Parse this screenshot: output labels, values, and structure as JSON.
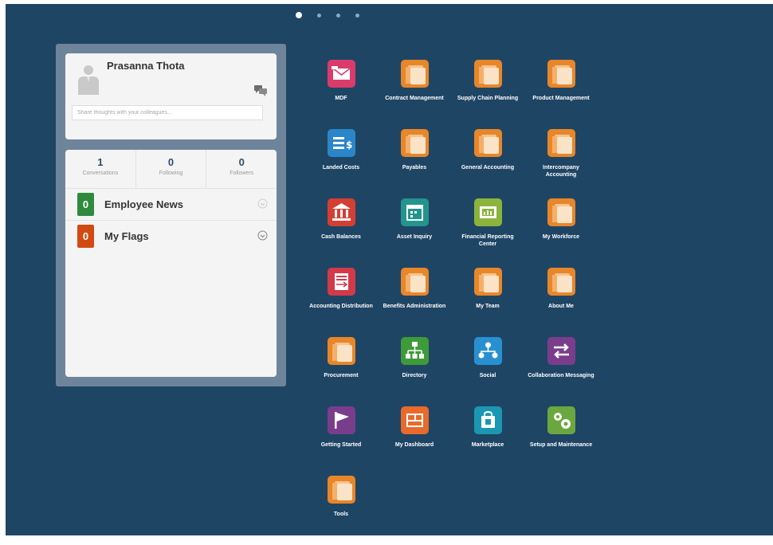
{
  "carousel": {
    "pages": 4,
    "active_page": 1
  },
  "profile": {
    "name": "Prasanna Thota",
    "status_placeholder": "Share thoughts with your colleagues..."
  },
  "stats": [
    {
      "count": "1",
      "label": "Conversations"
    },
    {
      "count": "0",
      "label": "Following"
    },
    {
      "count": "0",
      "label": "Followers"
    }
  ],
  "feeds": [
    {
      "count": "0",
      "label": "Employee News",
      "color": "#2f8a3e"
    },
    {
      "count": "0",
      "label": "My Flags",
      "color": "#d24a12"
    }
  ],
  "tiles": [
    {
      "label": "MDF",
      "icon": "envelope-icon",
      "color": "#d93b6b"
    },
    {
      "label": "Contract Management",
      "icon": "pages-icon",
      "color": "#e8862a"
    },
    {
      "label": "Supply Chain Planning",
      "icon": "pages-icon",
      "color": "#e8862a"
    },
    {
      "label": "Product Management",
      "icon": "pages-icon",
      "color": "#e8862a"
    },
    {
      "label": "Landed Costs",
      "icon": "cost-icon",
      "color": "#2b86c9"
    },
    {
      "label": "Payables",
      "icon": "pages-icon",
      "color": "#e8862a"
    },
    {
      "label": "General Accounting",
      "icon": "pages-icon",
      "color": "#e8862a"
    },
    {
      "label": "Intercompany Accounting",
      "icon": "pages-icon",
      "color": "#e8862a"
    },
    {
      "label": "Cash Balances",
      "icon": "bank-icon",
      "color": "#d33f32"
    },
    {
      "label": "Asset Inquiry",
      "icon": "calendar-icon",
      "color": "#23948e"
    },
    {
      "label": "Financial Reporting Center",
      "icon": "report-icon",
      "color": "#8cb33c"
    },
    {
      "label": "My Workforce",
      "icon": "pages-icon",
      "color": "#e8862a"
    },
    {
      "label": "Accounting Distribution",
      "icon": "ledger-icon",
      "color": "#d33a49"
    },
    {
      "label": "Benefits Administration",
      "icon": "pages-icon",
      "color": "#e8862a"
    },
    {
      "label": "My Team",
      "icon": "pages-icon",
      "color": "#e8862a"
    },
    {
      "label": "About Me",
      "icon": "pages-icon",
      "color": "#e8862a"
    },
    {
      "label": "Procurement",
      "icon": "pages-icon",
      "color": "#e8862a"
    },
    {
      "label": "Directory",
      "icon": "org-chart-icon",
      "color": "#3f9a3a"
    },
    {
      "label": "Social",
      "icon": "network-icon",
      "color": "#2890d1"
    },
    {
      "label": "Collaboration Messaging",
      "icon": "arrows-icon",
      "color": "#7a3d8c"
    },
    {
      "label": "Getting Started",
      "icon": "flag-icon",
      "color": "#7a3d8c"
    },
    {
      "label": "My Dashboard",
      "icon": "dashboard-icon",
      "color": "#e86a2c"
    },
    {
      "label": "Marketplace",
      "icon": "bag-icon",
      "color": "#1c97b3"
    },
    {
      "label": "Setup and Maintenance",
      "icon": "gears-icon",
      "color": "#6aa73e"
    },
    {
      "label": "Tools",
      "icon": "pages-icon",
      "color": "#e8862a"
    }
  ]
}
